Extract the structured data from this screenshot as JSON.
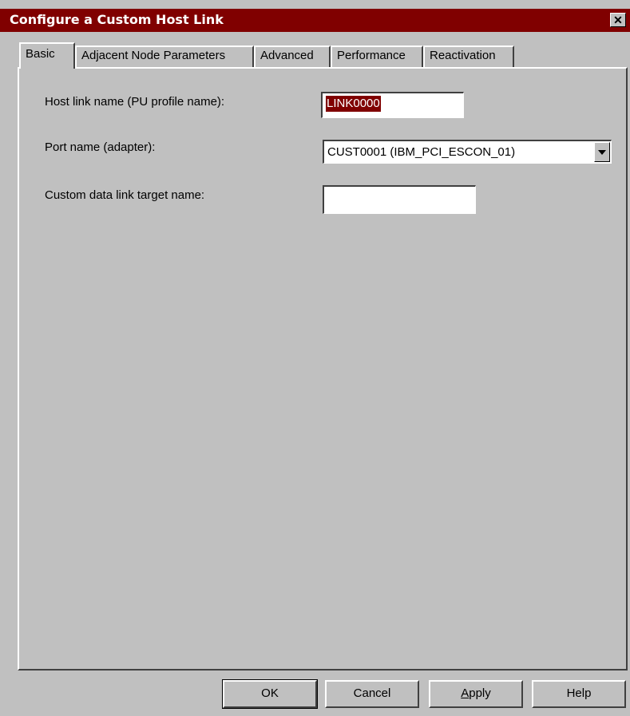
{
  "window": {
    "title": "Configure a Custom Host Link",
    "close_glyph": "✕"
  },
  "tabs": [
    {
      "label": "Basic",
      "active": true
    },
    {
      "label": "Adjacent Node Parameters",
      "active": false
    },
    {
      "label": "Advanced",
      "active": false
    },
    {
      "label": "Performance",
      "active": false
    },
    {
      "label": "Reactivation",
      "active": false
    }
  ],
  "form": {
    "host_link_label": "Host link name (PU profile name):",
    "host_link_value": "LINK0000",
    "port_label": "Port name (adapter):",
    "port_value": "CUST0001 (IBM_PCI_ESCON_01)",
    "target_label": "Custom data link target name:",
    "target_value": ""
  },
  "buttons": {
    "ok": "OK",
    "cancel": "Cancel",
    "apply": "Apply",
    "help": "Help"
  },
  "colors": {
    "titlebar": "#800000",
    "face": "#c0c0c0",
    "selection": "#800000"
  }
}
